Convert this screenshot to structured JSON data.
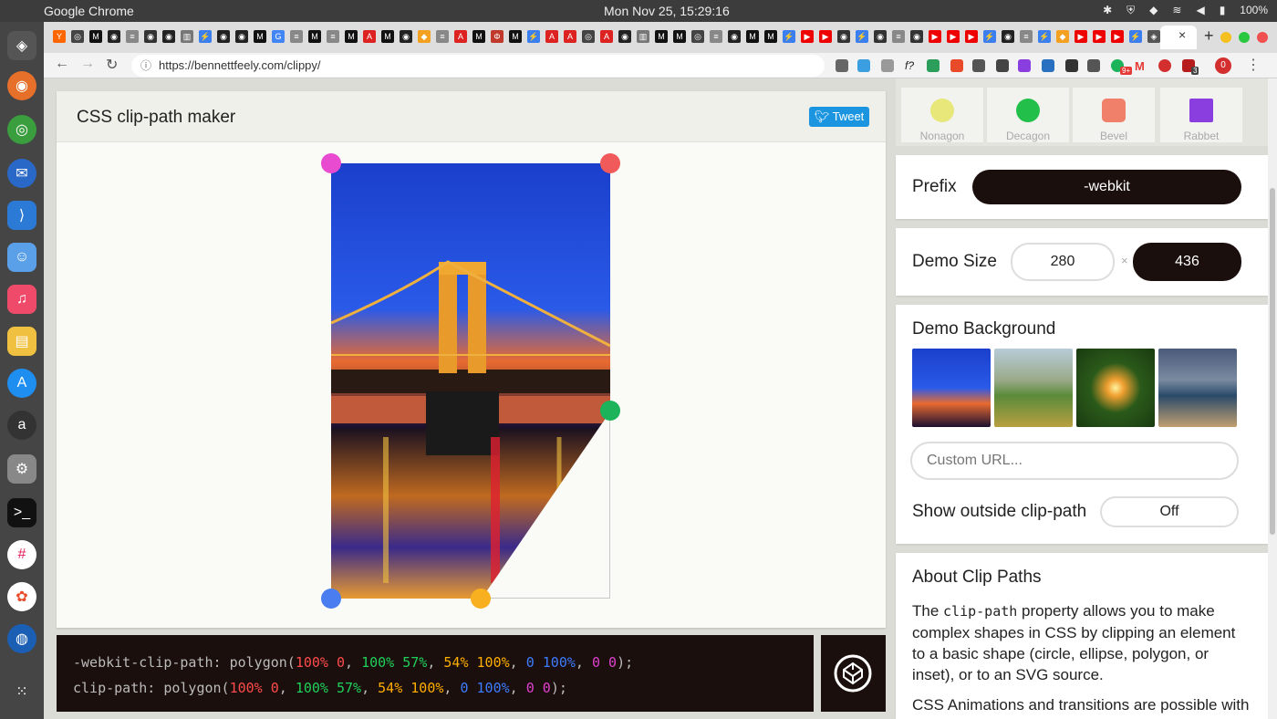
{
  "menubar": {
    "app_name": "Google Chrome",
    "datetime": "Mon Nov 25, 15:29:16",
    "battery": "100%"
  },
  "browser": {
    "url": "https://bennettfeely.com/clippy/",
    "tab_close": "×",
    "new_tab": "+",
    "ext_badge_1": "9+",
    "ext_badge_2": "3",
    "ext_badge_3": "0"
  },
  "header": {
    "title": "CSS clip-path maker",
    "tweet_label": "Tweet"
  },
  "shapes": {
    "items": [
      {
        "label": "Nonagon",
        "color": "#e8e87a"
      },
      {
        "label": "Decagon",
        "color": "#22c04a"
      },
      {
        "label": "Bevel",
        "color": "#f0806a"
      },
      {
        "label": "Rabbet",
        "color": "#8b3ee0"
      }
    ]
  },
  "prefix": {
    "label": "Prefix",
    "value": "-webkit"
  },
  "demo_size": {
    "label": "Demo Size",
    "width": "280",
    "separator": "×",
    "height": "436"
  },
  "demo_background": {
    "label": "Demo Background",
    "custom_url_placeholder": "Custom URL...",
    "show_outside_label": "Show outside clip-path",
    "show_outside_value": "Off"
  },
  "about": {
    "title": "About Clip Paths",
    "p1_before": "The ",
    "p1_code": "clip-path",
    "p1_after": " property allows you to make complex shapes in CSS by clipping an element to a basic shape (circle, ellipse, polygon, or inset), or to an SVG source.",
    "p2": "CSS Animations and transitions are possible with two or more clip-path shapes with the"
  },
  "code": {
    "line1_prop": "-webkit-clip-path: polygon(",
    "line2_prop": "clip-path: polygon(",
    "comma": ", ",
    "close": ");",
    "points": [
      {
        "text": "100% 0",
        "color": "#ff4b4b"
      },
      {
        "text": "100% 57%",
        "color": "#1fd05a"
      },
      {
        "text": "54% 100%",
        "color": "#ffae00"
      },
      {
        "text": "0 100%",
        "color": "#3d7cff"
      },
      {
        "text": "0 0",
        "color": "#e040d0"
      }
    ]
  },
  "colors": {
    "handle_top_left": "#e84ad0",
    "handle_top_right": "#f05a5a",
    "handle_mid_right": "#1db35a",
    "handle_bottom_mid": "#f8b020",
    "handle_bottom_left": "#4a7ef0"
  }
}
